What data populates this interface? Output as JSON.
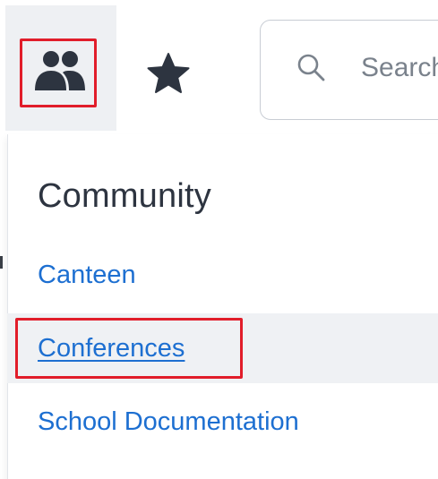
{
  "toolbar": {
    "community_icon": "people-icon",
    "favorites_icon": "star-icon",
    "search": {
      "icon": "search-icon",
      "placeholder": "Search"
    }
  },
  "menu": {
    "title": "Community",
    "items": [
      {
        "label": "Canteen"
      },
      {
        "label": "Conferences"
      },
      {
        "label": "School Documentation"
      }
    ]
  },
  "colors": {
    "link": "#1d6fd1",
    "highlight": "#e11d2a",
    "title": "#2d3440",
    "icon": "#2d3440"
  }
}
